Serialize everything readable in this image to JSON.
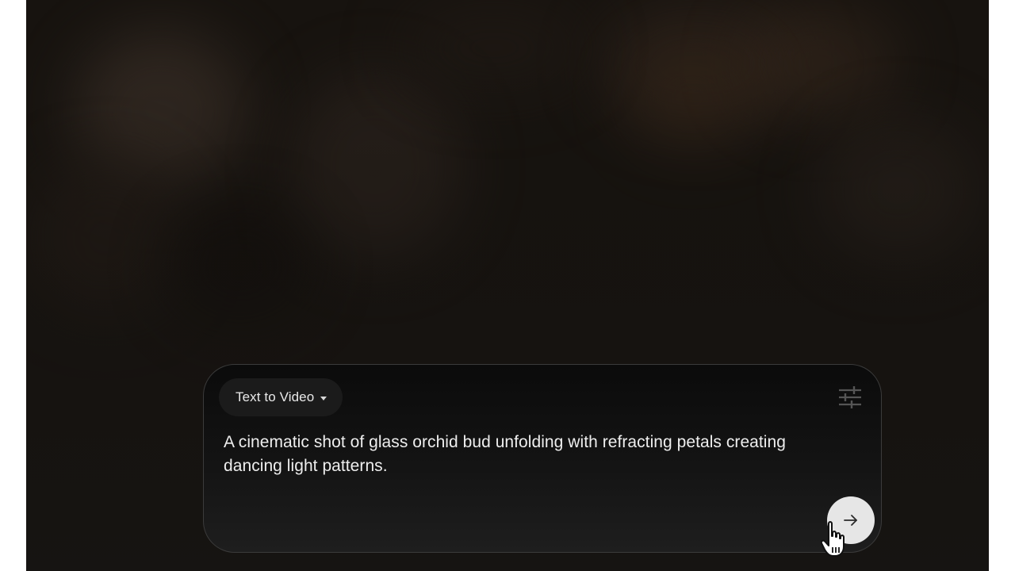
{
  "prompt_box": {
    "mode_selector": {
      "label": "Text to Video",
      "icon": "dropdown-caret-icon"
    },
    "settings_icon": "tune-sliders-icon",
    "prompt_text": "A cinematic shot of glass orchid bud unfolding with refracting petals creating dancing light patterns.",
    "submit_icon": "arrow-right-icon"
  },
  "pointer": "hand-pointer-cursor-icon",
  "colors": {
    "background": "#17130f",
    "panel": "#0b0b0b",
    "panel_border": "#3b3b3b",
    "chip": "#1b1b1b",
    "text": "#eeeeee",
    "submit_button": "#e6e6e6"
  }
}
